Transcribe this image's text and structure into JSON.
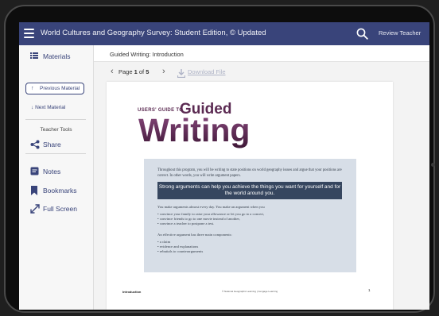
{
  "header": {
    "title": "World Cultures and Geography Survey: Student Edition, © Updated",
    "review_label": "Review Teacher"
  },
  "sidebar": {
    "materials_label": "Materials",
    "previous_label": "Previous Material",
    "next_label": "Next Material",
    "teacher_tools_label": "Teacher Tools",
    "items": [
      {
        "label": "Share",
        "icon": "share-icon"
      },
      {
        "label": "Notes",
        "icon": "notes-icon"
      },
      {
        "label": "Bookmarks",
        "icon": "bookmark-icon"
      },
      {
        "label": "Full Screen",
        "icon": "fullscreen-icon"
      }
    ]
  },
  "document": {
    "title": "Guided Writing: Introduction",
    "page_prefix": "Page",
    "current_page": "1",
    "page_of": "of",
    "total_pages": "5",
    "download_label": "Download File"
  },
  "page": {
    "small_heading": "USERS' GUIDE TO",
    "heading_guided": "Guided",
    "heading_writing": "Writing",
    "intro": "Throughout this program, you will be writing to state positions on world geography issues and argue that your positions are correct. In other words, you will write argument papers.",
    "banner": "Strong arguments can help you achieve the things you want for yourself and for the world around you.",
    "everyday": "You make arguments almost every day. You make an argument when you",
    "bullets1": [
      "• convince your family to raise your allowance or let you go to a concert,",
      "• convince friends to go to one movie instead of another,",
      "• convince a teacher to postpone a test."
    ],
    "components": "An effective argument has three main components:",
    "bullets2": [
      "• a claim",
      "• evidence and explanations",
      "• rebuttals to counterarguments"
    ],
    "footer_left": "Introduction",
    "footer_center": "© National Geographic Learning | Cengage Learning",
    "footer_right": "1"
  },
  "colors": {
    "topbar": "#39447a",
    "heading": "#5b2a52",
    "banner": "#36465f",
    "infobox": "#d7dee7"
  }
}
